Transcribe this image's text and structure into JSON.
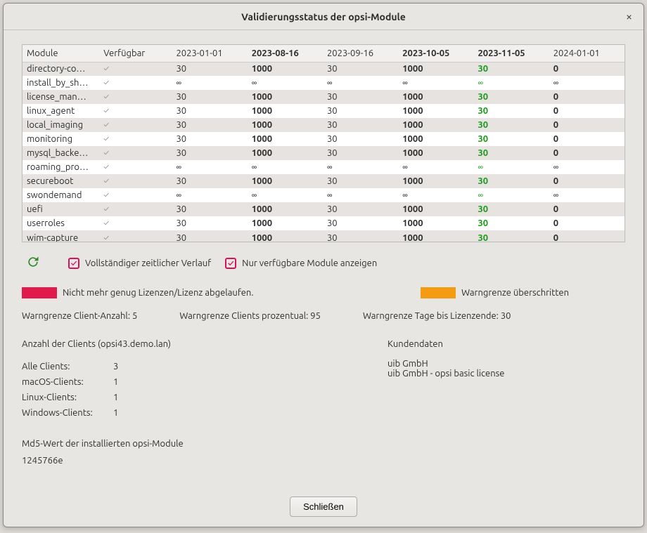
{
  "window": {
    "title": "Validierungsstatus der opsi-Module",
    "close_btn": "×"
  },
  "table": {
    "headers": {
      "module": "Module",
      "available": "Verfügbar",
      "d1": "2023-01-01",
      "d2": "2023-08-16",
      "d3": "2023-09-16",
      "d4": "2023-10-05",
      "d5": "2023-11-05",
      "d6": "2024-01-01"
    },
    "rows": [
      {
        "module": "directory-co…",
        "avail": "✓",
        "d1": "30",
        "d2": "1000",
        "d3": "30",
        "d4": "1000",
        "d5": "30",
        "d6": "0"
      },
      {
        "module": "install_by_sh…",
        "avail": "✓",
        "d1": "∞",
        "d2": "∞",
        "d3": "∞",
        "d4": "∞",
        "d5": "∞",
        "d6": "∞"
      },
      {
        "module": "license_man…",
        "avail": "✓",
        "d1": "30",
        "d2": "1000",
        "d3": "30",
        "d4": "1000",
        "d5": "30",
        "d6": "0"
      },
      {
        "module": "linux_agent",
        "avail": "✓",
        "d1": "30",
        "d2": "1000",
        "d3": "30",
        "d4": "1000",
        "d5": "30",
        "d6": "0"
      },
      {
        "module": "local_imaging",
        "avail": "✓",
        "d1": "30",
        "d2": "1000",
        "d3": "30",
        "d4": "1000",
        "d5": "30",
        "d6": "0"
      },
      {
        "module": "monitoring",
        "avail": "✓",
        "d1": "30",
        "d2": "1000",
        "d3": "30",
        "d4": "1000",
        "d5": "30",
        "d6": "0"
      },
      {
        "module": "mysql_backe…",
        "avail": "✓",
        "d1": "30",
        "d2": "1000",
        "d3": "30",
        "d4": "1000",
        "d5": "30",
        "d6": "0"
      },
      {
        "module": "roaming_pro…",
        "avail": "✓",
        "d1": "∞",
        "d2": "∞",
        "d3": "∞",
        "d4": "∞",
        "d5": "∞",
        "d6": "∞"
      },
      {
        "module": "secureboot",
        "avail": "✓",
        "d1": "30",
        "d2": "1000",
        "d3": "30",
        "d4": "1000",
        "d5": "30",
        "d6": "0"
      },
      {
        "module": "swondemand",
        "avail": "✓",
        "d1": "∞",
        "d2": "∞",
        "d3": "∞",
        "d4": "∞",
        "d5": "∞",
        "d6": "∞"
      },
      {
        "module": "uefi",
        "avail": "✓",
        "d1": "30",
        "d2": "1000",
        "d3": "30",
        "d4": "1000",
        "d5": "30",
        "d6": "0"
      },
      {
        "module": "userroles",
        "avail": "✓",
        "d1": "30",
        "d2": "1000",
        "d3": "30",
        "d4": "1000",
        "d5": "30",
        "d6": "0"
      },
      {
        "module": "wim-capture",
        "avail": "✓",
        "d1": "30",
        "d2": "1000",
        "d3": "30",
        "d4": "1000",
        "d5": "30",
        "d6": "0"
      }
    ]
  },
  "controls": {
    "full_history": "Vollständiger zeitlicher Verlauf",
    "only_available": "Nur verfügbare Module anzeigen"
  },
  "legend": {
    "expired": "Nicht mehr genug Lizenzen/Lizenz abgelaufen.",
    "warn": "Warngrenze überschritten"
  },
  "warn": {
    "client_count": "Warngrenze Client-Anzahl: 5",
    "client_percent": "Warngrenze Clients prozentual: 95",
    "days": "Warngrenze Tage bis Lizenzende: 30"
  },
  "clients": {
    "title": "Anzahl der Clients (opsi43.demo.lan)",
    "all_label": "Alle Clients:",
    "all_val": "3",
    "mac_label": "macOS-Clients:",
    "mac_val": "1",
    "linux_label": "Linux-Clients:",
    "linux_val": "1",
    "win_label": "Windows-Clients:",
    "win_val": "1"
  },
  "customer": {
    "title": "Kundendaten",
    "line1": "uib GmbH",
    "line2": "uib GmbH - opsi basic license"
  },
  "md5": {
    "label": "Md5-Wert der installierten opsi-Module",
    "value": "1245766e"
  },
  "footer": {
    "close": "Schließen"
  }
}
